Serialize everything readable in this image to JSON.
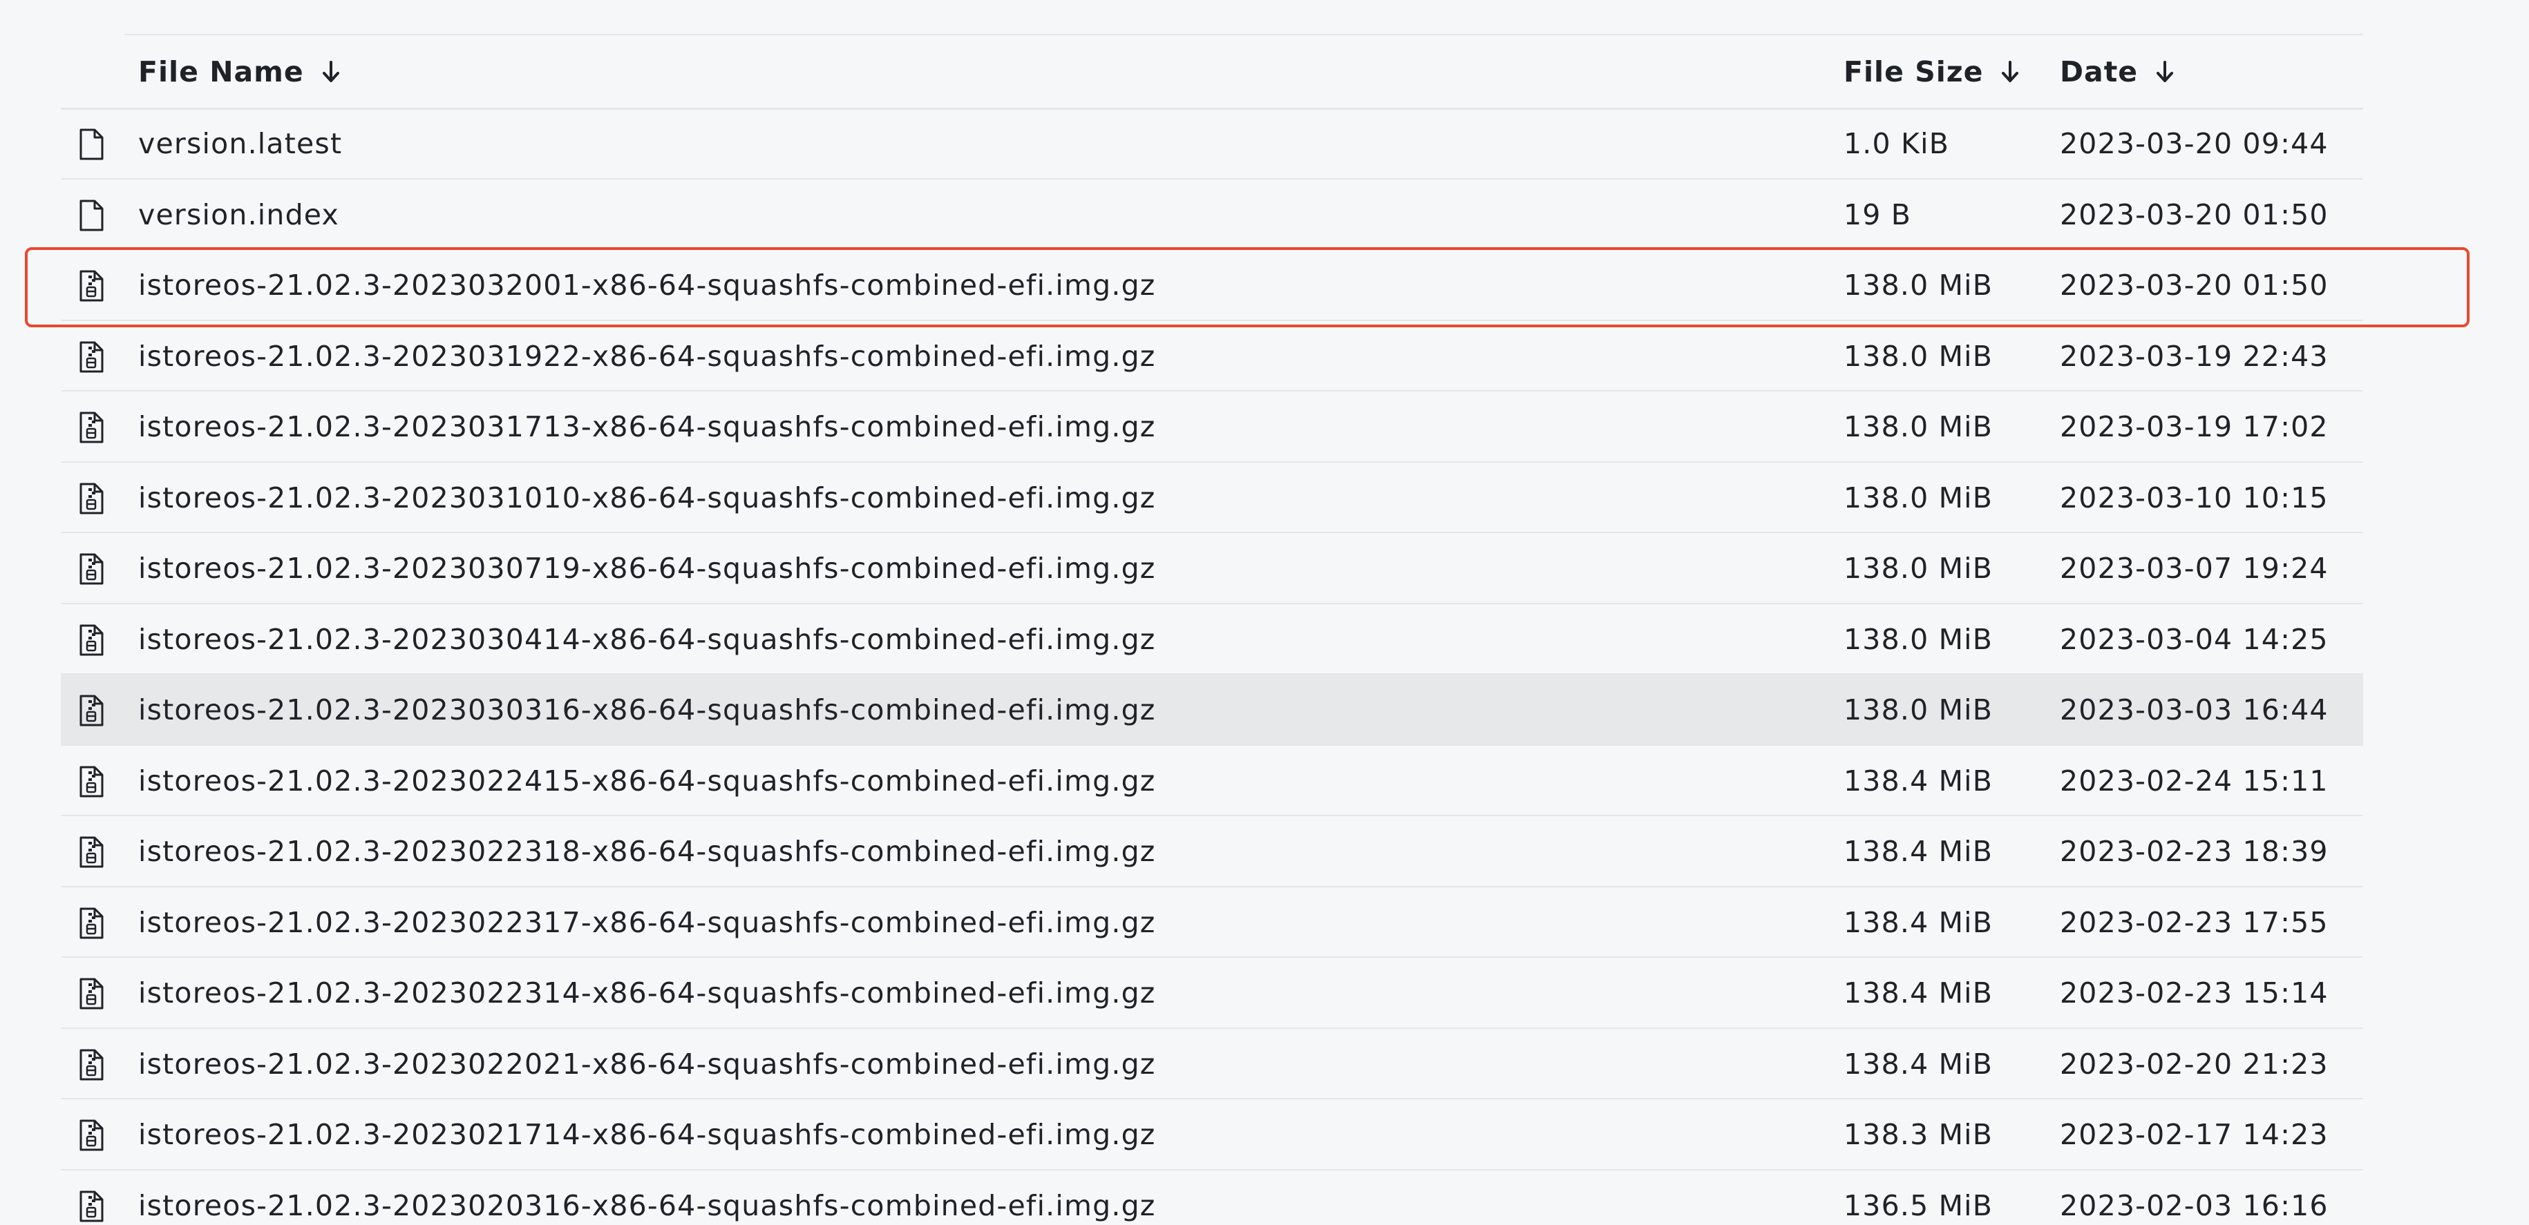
{
  "header": {
    "file_name": "File Name",
    "file_size": "File Size",
    "date": "Date",
    "sort_icon": "arrow-down-icon"
  },
  "rows": [
    {
      "name": "version.latest",
      "size": "1.0 KiB",
      "date": "2023-03-20 09:44",
      "icon": "file-icon"
    },
    {
      "name": "version.index",
      "size": "19 B",
      "date": "2023-03-20 01:50",
      "icon": "file-icon"
    },
    {
      "name": "istoreos-21.02.3-2023032001-x86-64-squashfs-combined-efi.img.gz",
      "size": "138.0 MiB",
      "date": "2023-03-20 01:50",
      "icon": "archive-file-icon"
    },
    {
      "name": "istoreos-21.02.3-2023031922-x86-64-squashfs-combined-efi.img.gz",
      "size": "138.0 MiB",
      "date": "2023-03-19 22:43",
      "icon": "archive-file-icon"
    },
    {
      "name": "istoreos-21.02.3-2023031713-x86-64-squashfs-combined-efi.img.gz",
      "size": "138.0 MiB",
      "date": "2023-03-19 17:02",
      "icon": "archive-file-icon"
    },
    {
      "name": "istoreos-21.02.3-2023031010-x86-64-squashfs-combined-efi.img.gz",
      "size": "138.0 MiB",
      "date": "2023-03-10 10:15",
      "icon": "archive-file-icon"
    },
    {
      "name": "istoreos-21.02.3-2023030719-x86-64-squashfs-combined-efi.img.gz",
      "size": "138.0 MiB",
      "date": "2023-03-07 19:24",
      "icon": "archive-file-icon"
    },
    {
      "name": "istoreos-21.02.3-2023030414-x86-64-squashfs-combined-efi.img.gz",
      "size": "138.0 MiB",
      "date": "2023-03-04 14:25",
      "icon": "archive-file-icon"
    },
    {
      "name": "istoreos-21.02.3-2023030316-x86-64-squashfs-combined-efi.img.gz",
      "size": "138.0 MiB",
      "date": "2023-03-03 16:44",
      "icon": "archive-file-icon",
      "hovered": true
    },
    {
      "name": "istoreos-21.02.3-2023022415-x86-64-squashfs-combined-efi.img.gz",
      "size": "138.4 MiB",
      "date": "2023-02-24 15:11",
      "icon": "archive-file-icon"
    },
    {
      "name": "istoreos-21.02.3-2023022318-x86-64-squashfs-combined-efi.img.gz",
      "size": "138.4 MiB",
      "date": "2023-02-23 18:39",
      "icon": "archive-file-icon"
    },
    {
      "name": "istoreos-21.02.3-2023022317-x86-64-squashfs-combined-efi.img.gz",
      "size": "138.4 MiB",
      "date": "2023-02-23 17:55",
      "icon": "archive-file-icon"
    },
    {
      "name": "istoreos-21.02.3-2023022314-x86-64-squashfs-combined-efi.img.gz",
      "size": "138.4 MiB",
      "date": "2023-02-23 15:14",
      "icon": "archive-file-icon"
    },
    {
      "name": "istoreos-21.02.3-2023022021-x86-64-squashfs-combined-efi.img.gz",
      "size": "138.4 MiB",
      "date": "2023-02-20 21:23",
      "icon": "archive-file-icon"
    },
    {
      "name": "istoreos-21.02.3-2023021714-x86-64-squashfs-combined-efi.img.gz",
      "size": "138.3 MiB",
      "date": "2023-02-17 14:23",
      "icon": "archive-file-icon"
    },
    {
      "name": "istoreos-21.02.3-2023020316-x86-64-squashfs-combined-efi.img.gz",
      "size": "136.5 MiB",
      "date": "2023-02-03 16:16",
      "icon": "archive-file-icon"
    }
  ],
  "colors": {
    "background": "#f6f7f9",
    "border": "#e4e6ea",
    "hover_row": "#e7e8ea",
    "highlight": "#e8492f",
    "text": "#1f2328"
  }
}
